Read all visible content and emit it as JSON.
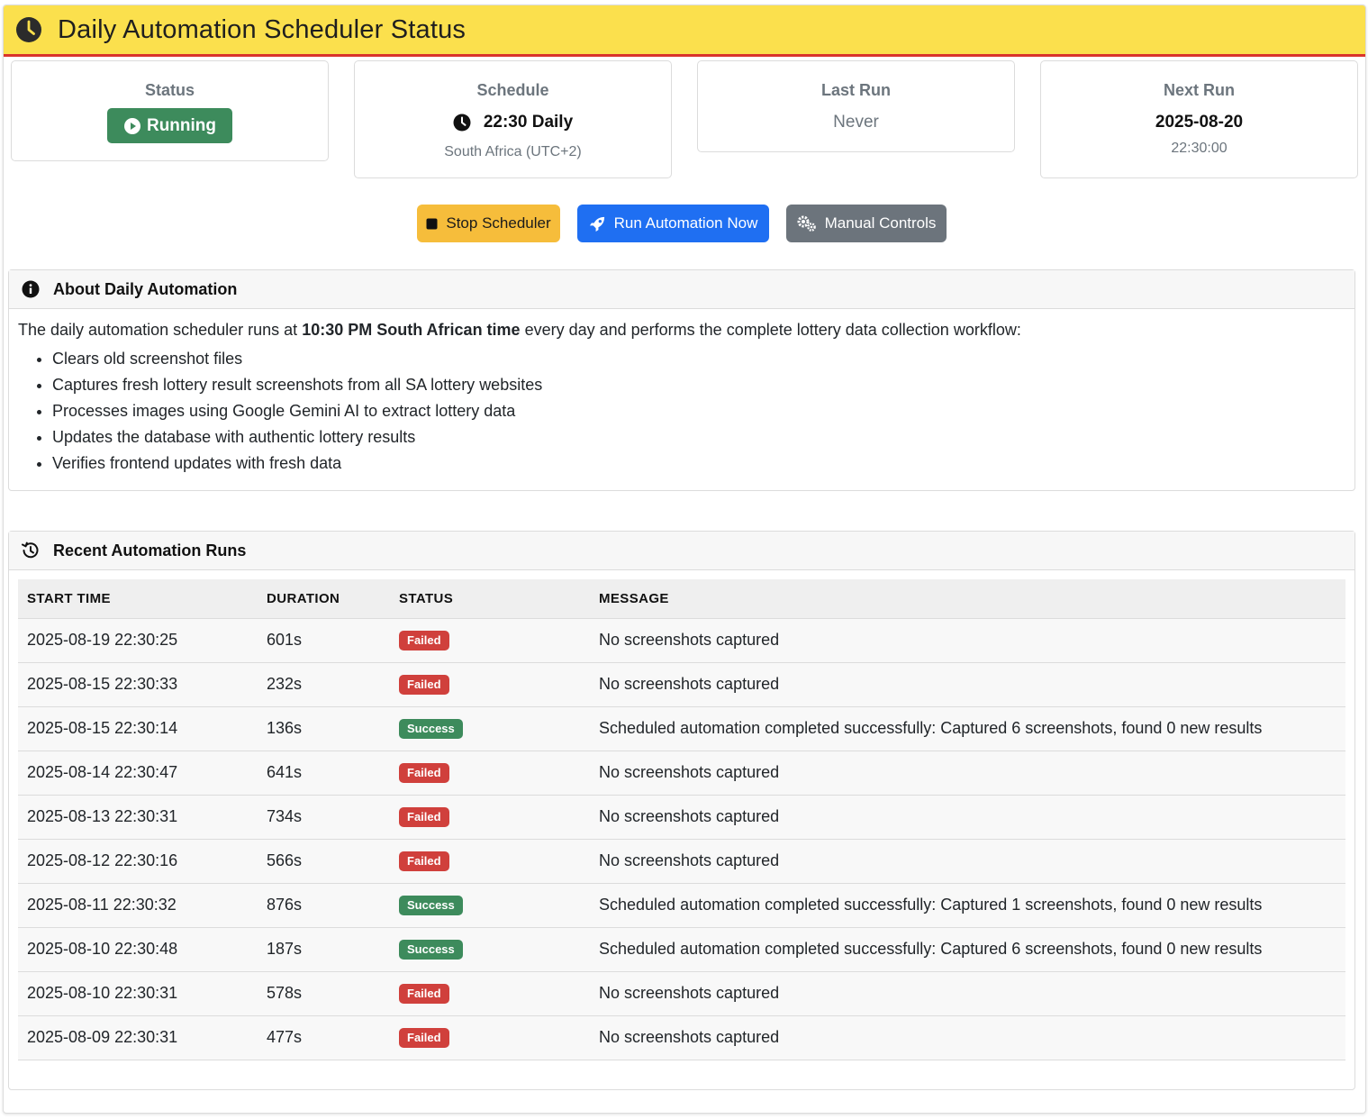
{
  "header": {
    "title": "Daily Automation Scheduler Status",
    "icon": "clock-icon"
  },
  "stats": {
    "status": {
      "title": "Status",
      "value": "Running",
      "color": "#3d8b5c"
    },
    "schedule": {
      "title": "Schedule",
      "value": "22:30 Daily",
      "sub": "South Africa (UTC+2)"
    },
    "last_run": {
      "title": "Last Run",
      "value": "Never"
    },
    "next_run": {
      "title": "Next Run",
      "value": "2025-08-20",
      "sub": "22:30:00"
    }
  },
  "buttons": {
    "stop": "Stop Scheduler",
    "run": "Run Automation Now",
    "manual": "Manual Controls"
  },
  "about": {
    "title": "About Daily Automation",
    "intro_before": "The daily automation scheduler runs at ",
    "intro_bold": "10:30 PM South African time",
    "intro_after": " every day and performs the complete lottery data collection workflow:",
    "items": [
      "Clears old screenshot files",
      "Captures fresh lottery result screenshots from all SA lottery websites",
      "Processes images using Google Gemini AI to extract lottery data",
      "Updates the database with authentic lottery results",
      "Verifies frontend updates with fresh data"
    ]
  },
  "runs": {
    "title": "Recent Automation Runs",
    "columns": [
      "START TIME",
      "DURATION",
      "STATUS",
      "MESSAGE"
    ],
    "rows": [
      {
        "start": "2025-08-19 22:30:25",
        "duration": "601s",
        "status": "Failed",
        "message": "No screenshots captured"
      },
      {
        "start": "2025-08-15 22:30:33",
        "duration": "232s",
        "status": "Failed",
        "message": "No screenshots captured"
      },
      {
        "start": "2025-08-15 22:30:14",
        "duration": "136s",
        "status": "Success",
        "message": "Scheduled automation completed successfully: Captured 6 screenshots, found 0 new results"
      },
      {
        "start": "2025-08-14 22:30:47",
        "duration": "641s",
        "status": "Failed",
        "message": "No screenshots captured"
      },
      {
        "start": "2025-08-13 22:30:31",
        "duration": "734s",
        "status": "Failed",
        "message": "No screenshots captured"
      },
      {
        "start": "2025-08-12 22:30:16",
        "duration": "566s",
        "status": "Failed",
        "message": "No screenshots captured"
      },
      {
        "start": "2025-08-11 22:30:32",
        "duration": "876s",
        "status": "Success",
        "message": "Scheduled automation completed successfully: Captured 1 screenshots, found 0 new results"
      },
      {
        "start": "2025-08-10 22:30:48",
        "duration": "187s",
        "status": "Success",
        "message": "Scheduled automation completed successfully: Captured 6 screenshots, found 0 new results"
      },
      {
        "start": "2025-08-10 22:30:31",
        "duration": "578s",
        "status": "Failed",
        "message": "No screenshots captured"
      },
      {
        "start": "2025-08-09 22:30:31",
        "duration": "477s",
        "status": "Failed",
        "message": "No screenshots captured"
      }
    ]
  },
  "colors": {
    "header_bg": "#fbe04d",
    "header_border": "#d9342b",
    "success": "#3d8b5c",
    "failed": "#d0403c",
    "warning": "#f6bd3b",
    "primary": "#1f6ff2",
    "secondary": "#6c747c"
  }
}
